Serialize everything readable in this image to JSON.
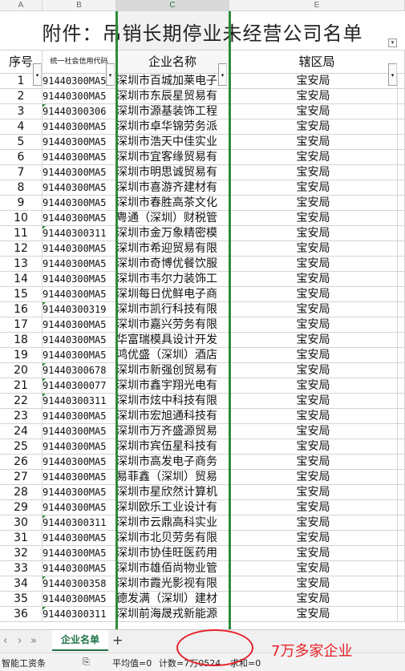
{
  "columns": [
    "A",
    "B",
    "C",
    "E"
  ],
  "title": "附件：吊销长期停业未经营公司名单",
  "headers": {
    "seq": "序号",
    "code": "统一社会信用代码",
    "name": "企业名称",
    "bureau": "辖区局"
  },
  "rows": [
    {
      "seq": "1",
      "code": "91440300MA5",
      "name": "深圳市百城加莱电子",
      "bureau": "宝安局"
    },
    {
      "seq": "2",
      "code": "91440300MA5",
      "name": "深圳市东辰星贸易有",
      "bureau": "宝安局"
    },
    {
      "seq": "3",
      "code": "91440300306",
      "name": "深圳市源基装饰工程",
      "bureau": "宝安局"
    },
    {
      "seq": "4",
      "code": "91440300MA5",
      "name": "深圳市卓华锦劳务派",
      "bureau": "宝安局"
    },
    {
      "seq": "5",
      "code": "91440300MA5",
      "name": "深圳市浩天中佳实业",
      "bureau": "宝安局"
    },
    {
      "seq": "6",
      "code": "91440300MA5",
      "name": "深圳市宜客缘贸易有",
      "bureau": "宝安局"
    },
    {
      "seq": "7",
      "code": "91440300MA5",
      "name": "深圳市明思诚贸易有",
      "bureau": "宝安局"
    },
    {
      "seq": "8",
      "code": "91440300MA5",
      "name": "深圳市喜游齐建材有",
      "bureau": "宝安局"
    },
    {
      "seq": "9",
      "code": "91440300MA5",
      "name": "深圳市春胜高茶文化",
      "bureau": "宝安局"
    },
    {
      "seq": "10",
      "code": "91440300MA5",
      "name": "粤通（深圳）财税管",
      "bureau": "宝安局"
    },
    {
      "seq": "11",
      "code": "91440300311",
      "name": "深圳市金万象精密模",
      "bureau": "宝安局"
    },
    {
      "seq": "12",
      "code": "91440300MA5",
      "name": "深圳市希迎贸易有限",
      "bureau": "宝安局"
    },
    {
      "seq": "13",
      "code": "91440300MA5",
      "name": "深圳市奇博优餐饮服",
      "bureau": "宝安局"
    },
    {
      "seq": "14",
      "code": "91440300MA5",
      "name": "深圳市韦尔力装饰工",
      "bureau": "宝安局"
    },
    {
      "seq": "15",
      "code": "91440300MA5",
      "name": "深圳每日优鲜电子商",
      "bureau": "宝安局"
    },
    {
      "seq": "16",
      "code": "91440300319",
      "name": "深圳市凯行科技有限",
      "bureau": "宝安局"
    },
    {
      "seq": "17",
      "code": "91440300MA5",
      "name": "深圳市嘉兴劳务有限",
      "bureau": "宝安局"
    },
    {
      "seq": "18",
      "code": "91440300MA5",
      "name": "华富瑞模具设计开发",
      "bureau": "宝安局"
    },
    {
      "seq": "19",
      "code": "91440300MA5",
      "name": "鸿优盛（深圳）酒店",
      "bureau": "宝安局"
    },
    {
      "seq": "20",
      "code": "91440300678",
      "name": "深圳市新强创贸易有",
      "bureau": "宝安局"
    },
    {
      "seq": "21",
      "code": "91440300077",
      "name": "深圳市鑫宇翔光电有",
      "bureau": "宝安局"
    },
    {
      "seq": "22",
      "code": "91440300311",
      "name": "深圳市炫中科技有限",
      "bureau": "宝安局"
    },
    {
      "seq": "23",
      "code": "91440300MA5",
      "name": "深圳市宏旭通科技有",
      "bureau": "宝安局"
    },
    {
      "seq": "24",
      "code": "91440300MA5",
      "name": "深圳市万齐盛源贸易",
      "bureau": "宝安局"
    },
    {
      "seq": "25",
      "code": "91440300MA5",
      "name": "深圳市宾伍星科技有",
      "bureau": "宝安局"
    },
    {
      "seq": "26",
      "code": "91440300MA5",
      "name": "深圳市高发电子商务",
      "bureau": "宝安局"
    },
    {
      "seq": "27",
      "code": "91440300MA5",
      "name": "易菲鑫（深圳）贸易",
      "bureau": "宝安局"
    },
    {
      "seq": "28",
      "code": "91440300MA5",
      "name": "深圳市星欣然计算机",
      "bureau": "宝安局"
    },
    {
      "seq": "29",
      "code": "91440300MA5",
      "name": "深圳欧乐工业设计有",
      "bureau": "宝安局"
    },
    {
      "seq": "30",
      "code": "91440300311",
      "name": "深圳市云鼎高科实业",
      "bureau": "宝安局"
    },
    {
      "seq": "31",
      "code": "91440300MA5",
      "name": "深圳市北贝劳务有限",
      "bureau": "宝安局"
    },
    {
      "seq": "32",
      "code": "91440300MA5",
      "name": "深圳市协佳旺医药用",
      "bureau": "宝安局"
    },
    {
      "seq": "33",
      "code": "91440300MA5",
      "name": "深圳市雄佰尚物业管",
      "bureau": "宝安局"
    },
    {
      "seq": "34",
      "code": "91440300358",
      "name": "深圳市霞光影视有限",
      "bureau": "宝安局"
    },
    {
      "seq": "35",
      "code": "91440300MA5",
      "name": "德发满（深圳）建材",
      "bureau": "宝安局"
    },
    {
      "seq": "36",
      "code": "91440300311",
      "name": "深圳前海晟戎新能源",
      "bureau": "宝安局"
    }
  ],
  "tabs": {
    "nav": [
      "‹",
      "›",
      "»"
    ],
    "sheet": "企业名单",
    "add": "+"
  },
  "status": {
    "app": "智能工资条",
    "average": "平均值=0",
    "count": "计数=7万0524",
    "sum": "求和=0"
  },
  "annotation": "7万多家企业",
  "accent": "#217346",
  "highlight": "#e8232a"
}
